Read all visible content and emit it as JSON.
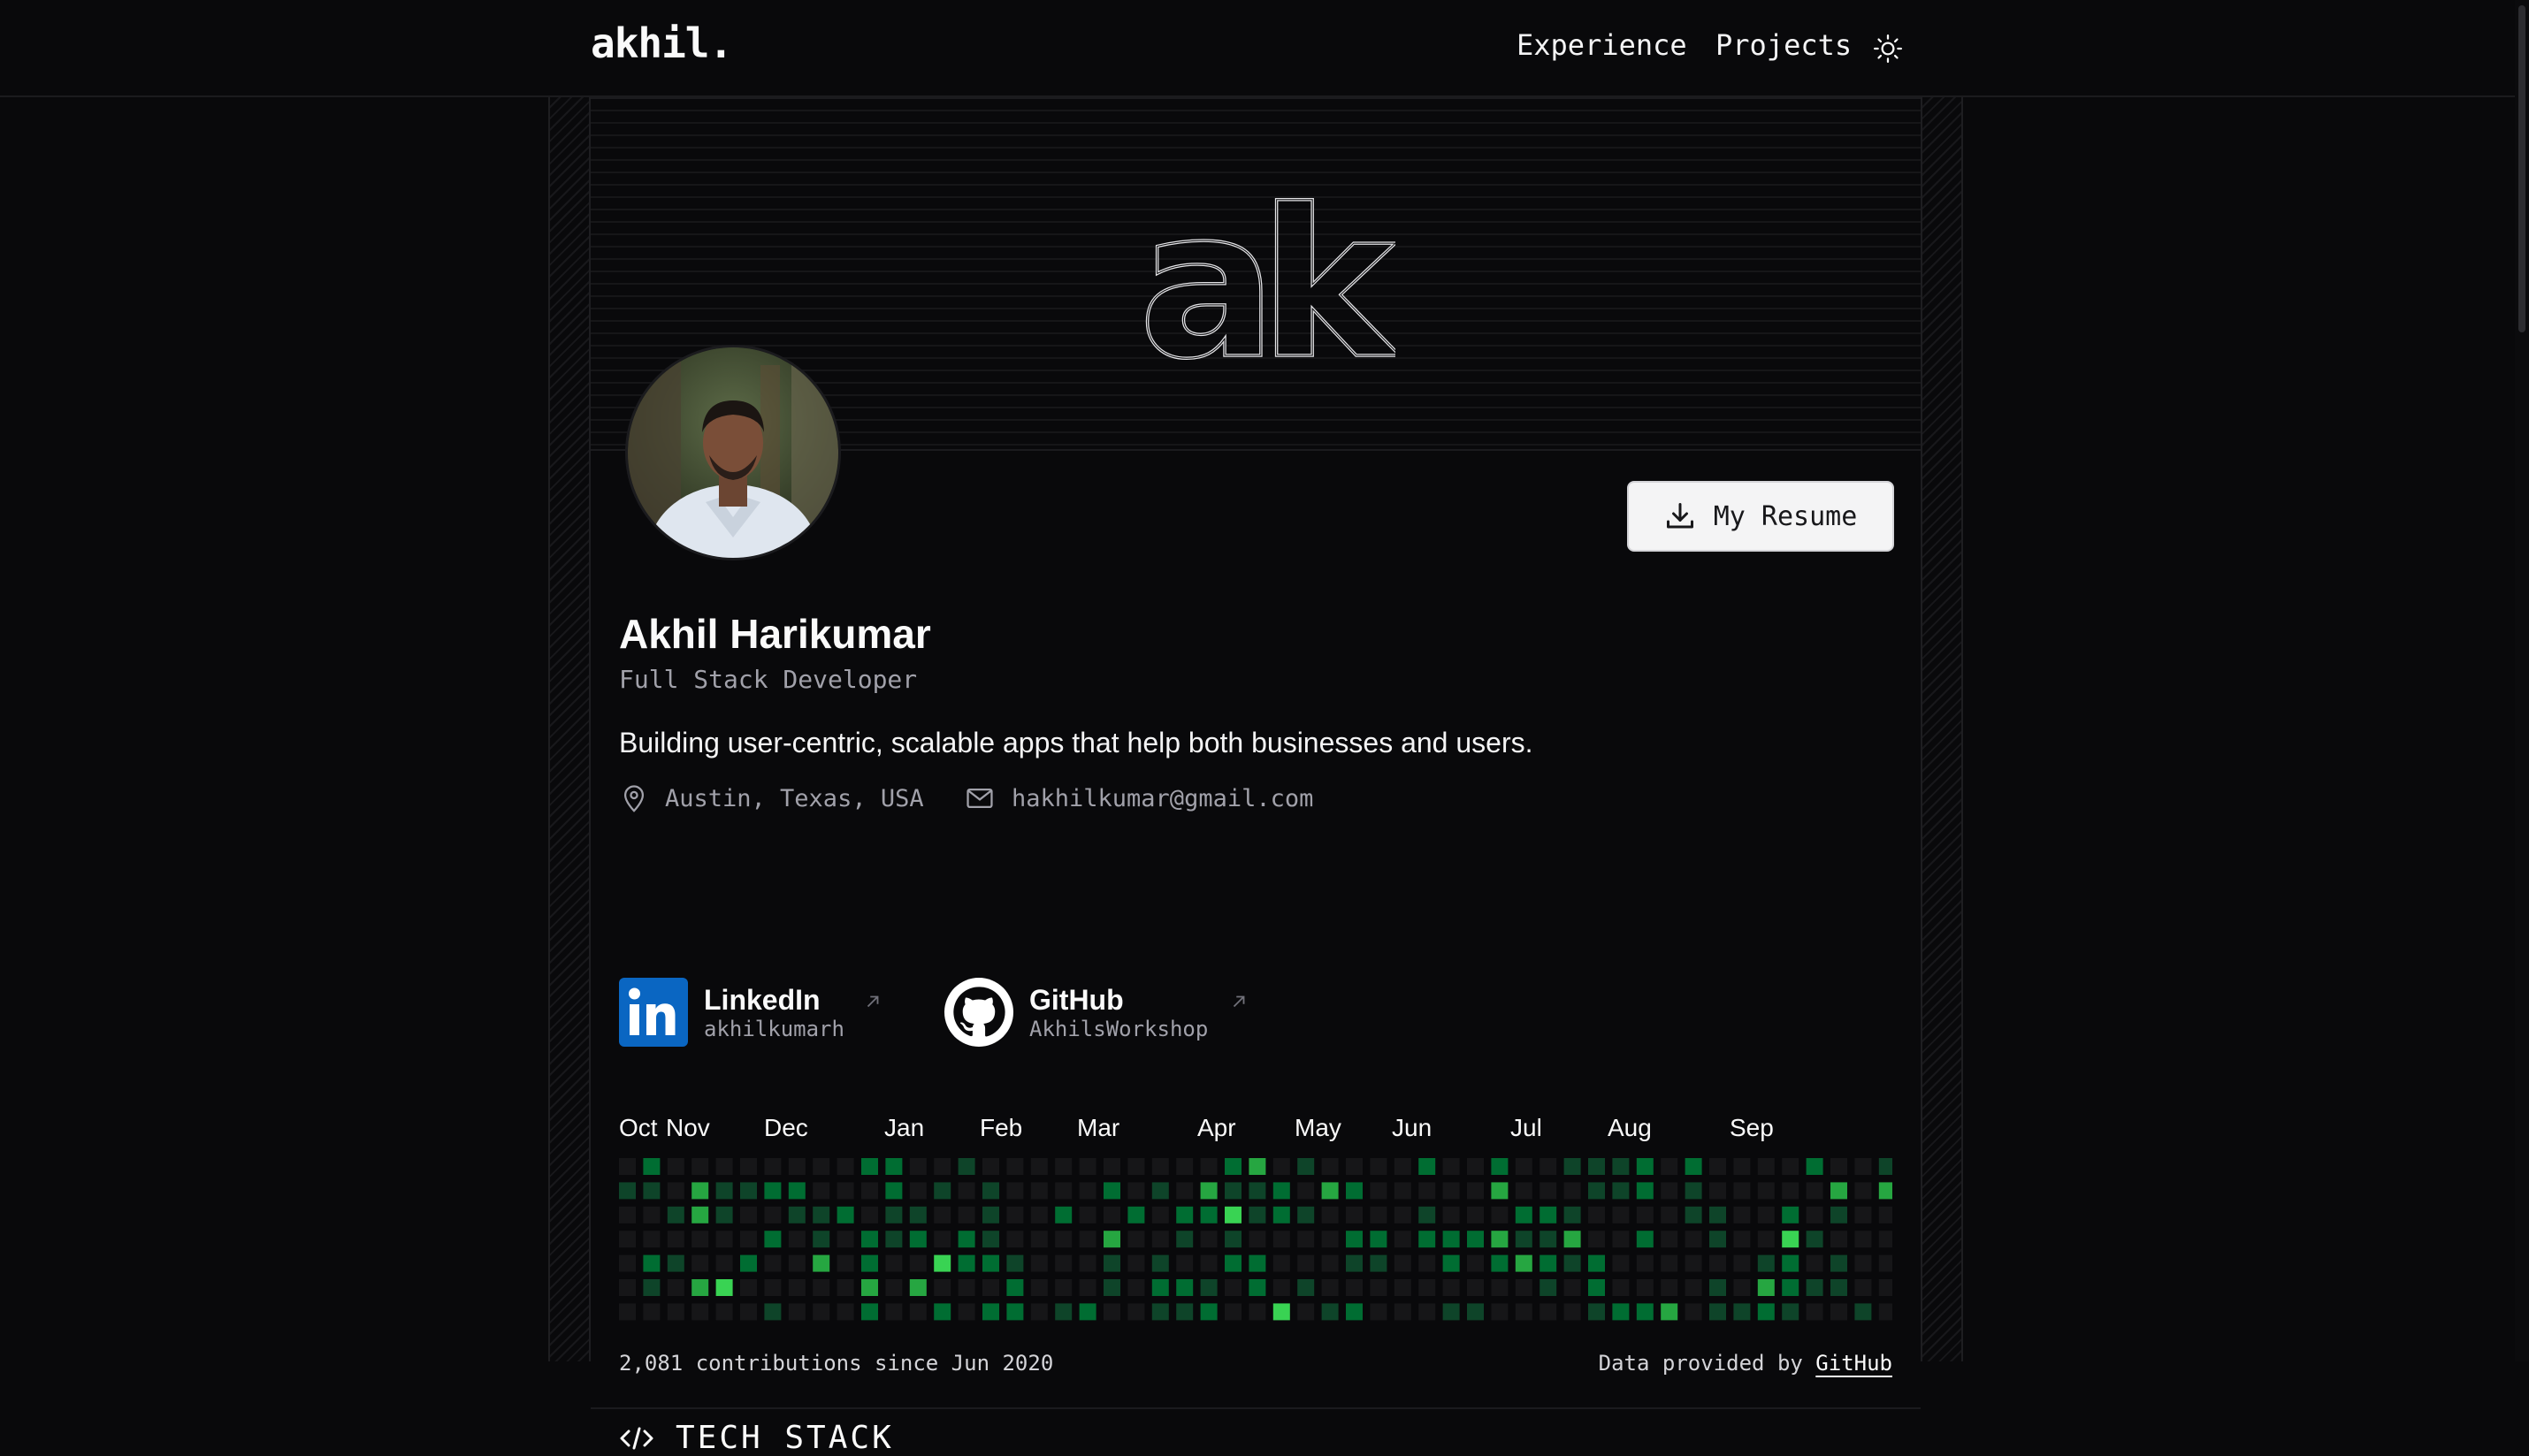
{
  "header": {
    "logo": "akhil.",
    "nav": [
      {
        "label": "Experience"
      },
      {
        "label": "Projects"
      }
    ],
    "theme_icon": "sun-icon"
  },
  "hero": {
    "monogram": "ak"
  },
  "profile": {
    "name": "Akhil Harikumar",
    "role": "Full Stack Developer",
    "tagline": "Building user-centric, scalable apps that help both businesses and users.",
    "location": "Austin, Texas, USA",
    "email": "hakhilkumar@gmail.com",
    "resume_label": "My Resume"
  },
  "socials": [
    {
      "title": "LinkedIn",
      "handle": "akhilkumarh",
      "icon": "linkedin-icon"
    },
    {
      "title": "GitHub",
      "handle": "AkhilsWorkshop",
      "icon": "github-icon"
    }
  ],
  "contributions": {
    "months": [
      "Oct",
      "Nov",
      "Dec",
      "Jan",
      "Feb",
      "Mar",
      "Apr",
      "May",
      "Jun",
      "Jul",
      "Aug",
      "Sep"
    ],
    "summary": "2,081 contributions since Jun 2020",
    "credit_prefix": "Data provided by",
    "credit_link": "GitHub",
    "colors": [
      "#161618",
      "#0e4429",
      "#006d32",
      "#26a641",
      "#39d353"
    ]
  },
  "tech_stack": {
    "title": "TECH STACK"
  }
}
